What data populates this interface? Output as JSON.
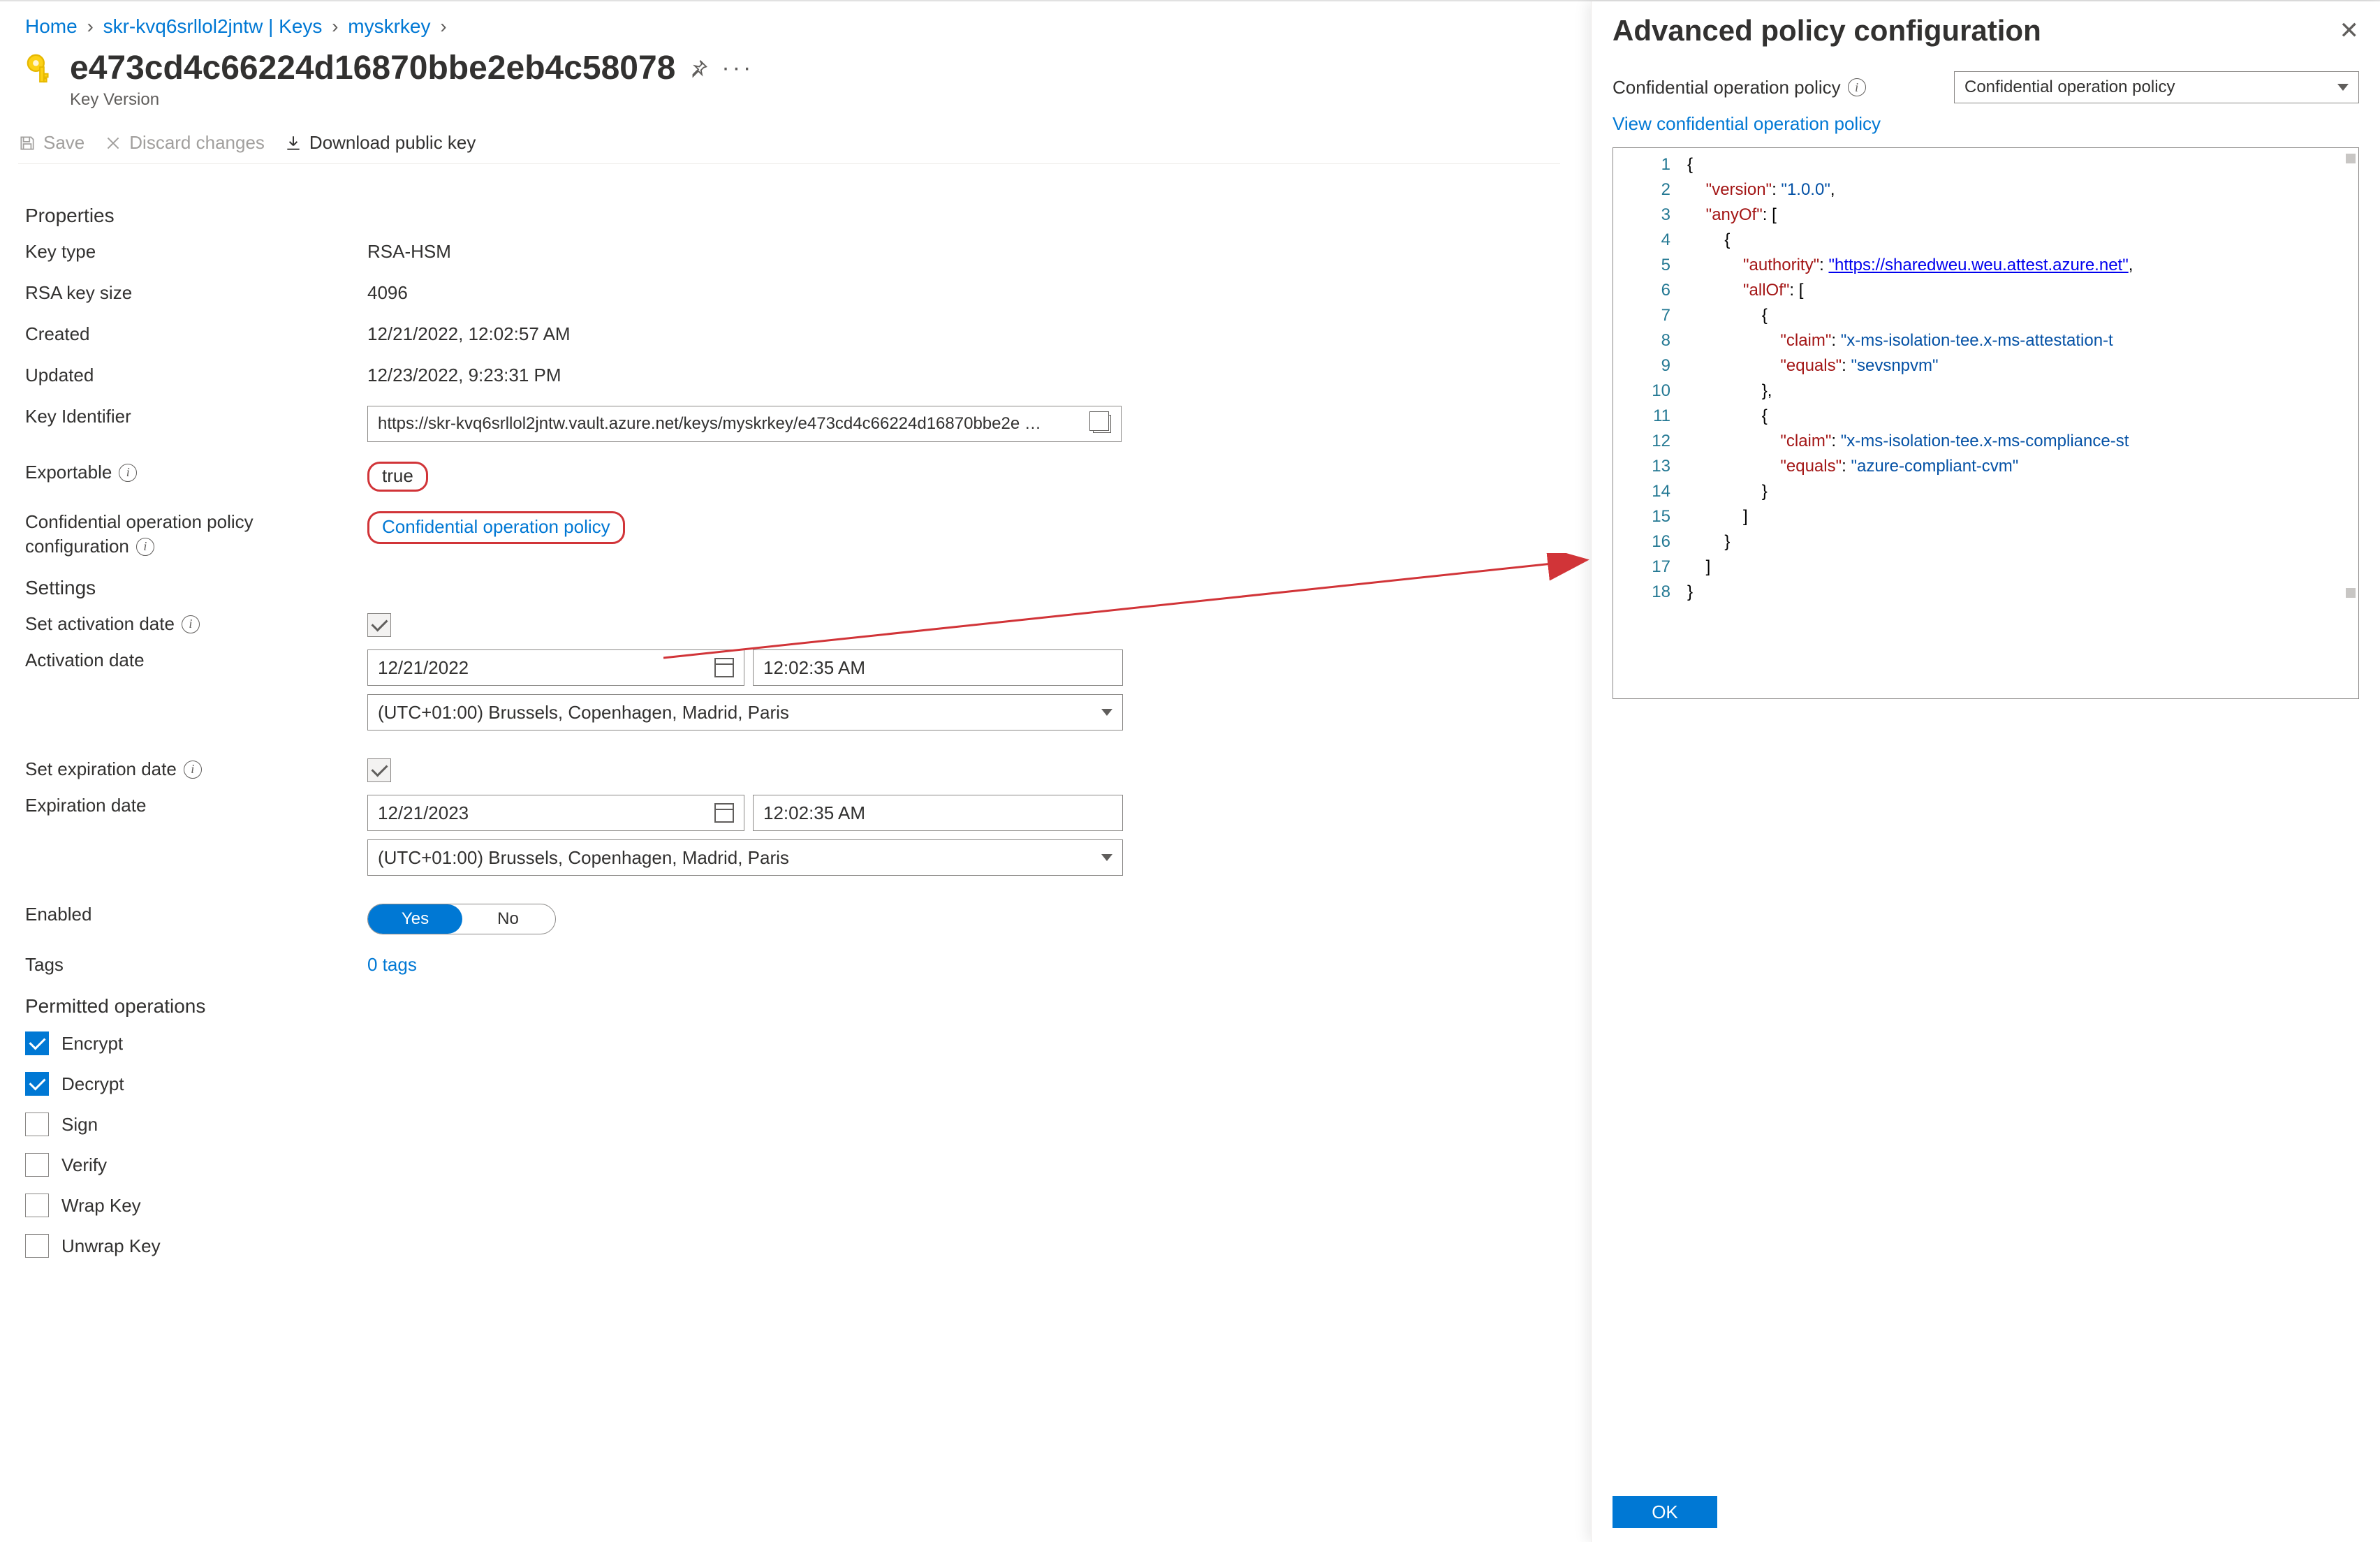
{
  "breadcrumb": {
    "home": "Home",
    "vault": "skr-kvq6srllol2jntw | Keys",
    "key": "myskrkey"
  },
  "page": {
    "title": "e473cd4c66224d16870bbe2eb4c58078",
    "subtitle": "Key Version"
  },
  "toolbar": {
    "save": "Save",
    "discard": "Discard changes",
    "download": "Download public key"
  },
  "sections": {
    "properties": "Properties",
    "settings": "Settings",
    "permitted": "Permitted operations"
  },
  "properties": {
    "key_type_label": "Key type",
    "key_type_value": "RSA-HSM",
    "rsa_size_label": "RSA key size",
    "rsa_size_value": "4096",
    "created_label": "Created",
    "created_value": "12/21/2022, 12:02:57 AM",
    "updated_label": "Updated",
    "updated_value": "12/23/2022, 9:23:31 PM",
    "key_id_label": "Key Identifier",
    "key_id_value": "https://skr-kvq6srllol2jntw.vault.azure.net/keys/myskrkey/e473cd4c66224d16870bbe2e …",
    "exportable_label": "Exportable",
    "exportable_value": "true",
    "conf_label_1": "Confidential operation policy",
    "conf_label_2": "configuration",
    "conf_link": "Confidential operation policy"
  },
  "settings": {
    "set_activation_label": "Set activation date",
    "activation_date_label": "Activation date",
    "activation_date": "12/21/2022",
    "activation_time": "12:02:35 AM",
    "timezone": "(UTC+01:00) Brussels, Copenhagen, Madrid, Paris",
    "set_expiration_label": "Set expiration date",
    "expiration_date_label": "Expiration date",
    "expiration_date": "12/21/2023",
    "expiration_time": "12:02:35 AM",
    "enabled_label": "Enabled",
    "toggle_yes": "Yes",
    "toggle_no": "No",
    "tags_label": "Tags",
    "tags_value": "0 tags"
  },
  "permitted": {
    "encrypt": "Encrypt",
    "decrypt": "Decrypt",
    "sign": "Sign",
    "verify": "Verify",
    "wrap": "Wrap Key",
    "unwrap": "Unwrap Key"
  },
  "panel": {
    "title": "Advanced policy configuration",
    "field_label": "Confidential operation policy",
    "select_value": "Confidential operation policy",
    "view_link": "View confidential operation policy",
    "ok": "OK",
    "code": {
      "l1": "{",
      "l2a": "    \"version\"",
      "l2b": ": ",
      "l2c": "\"1.0.0\"",
      "l2d": ",",
      "l3a": "    \"anyOf\"",
      "l3b": ": [",
      "l4": "        {",
      "l5a": "            \"authority\"",
      "l5b": ": ",
      "l5c": "\"https://sharedweu.weu.attest.azure.net\"",
      "l5d": ",",
      "l6a": "            \"allOf\"",
      "l6b": ": [",
      "l7": "                {",
      "l8a": "                    \"claim\"",
      "l8b": ": ",
      "l8c": "\"x-ms-isolation-tee.x-ms-attestation-t",
      "l9a": "                    \"equals\"",
      "l9b": ": ",
      "l9c": "\"sevsnpvm\"",
      "l10": "                },",
      "l11": "                {",
      "l12a": "                    \"claim\"",
      "l12b": ": ",
      "l12c": "\"x-ms-isolation-tee.x-ms-compliance-st",
      "l13a": "                    \"equals\"",
      "l13b": ": ",
      "l13c": "\"azure-compliant-cvm\"",
      "l14": "                }",
      "l15": "            ]",
      "l16": "        }",
      "l17": "    ]",
      "l18": "}"
    }
  }
}
